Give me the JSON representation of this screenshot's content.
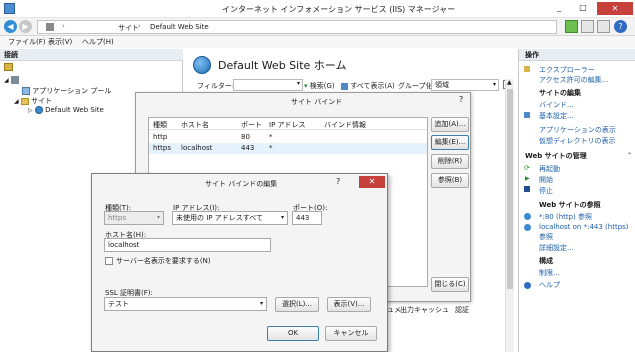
{
  "window": {
    "title": "インターネット インフォメーション サービス (IIS) マネージャー"
  },
  "address": {
    "segments": [
      "サイト",
      "Default Web Site"
    ]
  },
  "menu": [
    "ファイル(F)",
    "表示(V)",
    "ヘルプ(H)"
  ],
  "connections": {
    "header": "接続",
    "tree": [
      "",
      "アプリケーション プール",
      "サイト",
      "Default Web Site"
    ]
  },
  "main": {
    "title": "Default Web Site ホーム",
    "filter_label": "フィルター:",
    "search_label": "検索(G)",
    "show_all": "すべて表示(A)",
    "group_label": "グループ化:",
    "group_value": "領域",
    "bottom_items": [
      "ュメ",
      "出力キャッシュ",
      "認証"
    ]
  },
  "actions": {
    "header": "操作",
    "explore": "エクスプローラー",
    "edit_perms": "アクセス許可の編集...",
    "edit_site_title": "サイトの編集",
    "bindings": "バインド...",
    "basic_settings": "基本設定...",
    "view_apps": "アプリケーションの表示",
    "view_vdirs": "仮想ディレクトリの表示",
    "manage_title": "Web サイトの管理",
    "restart": "再起動",
    "start": "開始",
    "stop": "停止",
    "browse_title": "Web サイトの参照",
    "browse_http": "*:80 (http) 参照",
    "browse_https_1": "localhost on *:443 (https)",
    "browse_https_2": "参照",
    "advanced": "詳細設定...",
    "config_title": "構成",
    "limits": "制限...",
    "help": "ヘルプ"
  },
  "site_bindings": {
    "title": "サイト バインド",
    "help_q": "?",
    "columns": [
      "種類",
      "ホスト名",
      "ポート",
      "IP アドレス",
      "バインド情報"
    ],
    "rows": [
      [
        "http",
        "",
        "80",
        "*",
        ""
      ],
      [
        "https",
        "localhost",
        "443",
        "*",
        ""
      ]
    ],
    "add": "追加(A)...",
    "edit": "編集(E)...",
    "remove": "削除(R)",
    "browse": "参照(B)",
    "close": "閉じる(C)"
  },
  "edit_binding": {
    "title": "サイト バインドの編集",
    "help_q": "?",
    "type_label": "種類(T):",
    "type_value": "https",
    "ip_label": "IP アドレス(I):",
    "ip_value": "未使用の IP アドレスすべて",
    "port_label": "ポート(O):",
    "port_value": "443",
    "host_label": "ホスト名(H):",
    "host_value": "localhost",
    "sni_label": "サーバー名表示を要求する(N)",
    "ssl_label": "SSL 証明書(F):",
    "ssl_value": "テスト",
    "select": "選択(L)...",
    "view": "表示(V)...",
    "ok": "OK",
    "cancel": "キャンセル"
  }
}
